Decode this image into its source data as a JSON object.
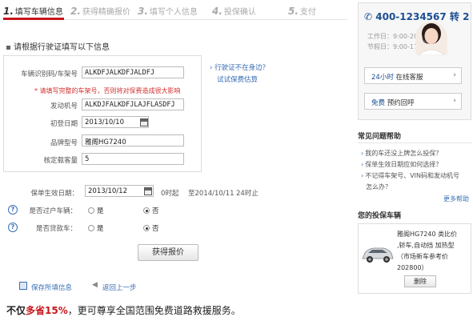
{
  "steps": [
    {
      "num": "1.",
      "label": "填写车辆信息"
    },
    {
      "num": "2.",
      "label": "获得精确报价"
    },
    {
      "num": "3.",
      "label": "填写个人信息"
    },
    {
      "num": "4.",
      "label": "投保确认"
    },
    {
      "num": "5.",
      "label": "支付"
    }
  ],
  "section_title": "请根据行驶证填写以下信息",
  "form": {
    "vin_label": "车辆识别码/车架号",
    "vin_value": "ALKDFJALKDFJALDFJ",
    "vin_warning": "* 请填写完整的车架号，否则将对保费造成很大影响",
    "engine_label": "发动机号",
    "engine_value": "ALKDJFALKDFJLAJFLASDFJ",
    "reg_date_label": "初登日期",
    "reg_date_value": "2013/10/10",
    "model_label": "品牌型号",
    "model_value": "雅阁HG7240",
    "seats_label": "核定载客量",
    "seats_value": "5"
  },
  "help": {
    "no_license": "行驶证不在身边？",
    "try_estimate": "试试保费估算"
  },
  "policy": {
    "start_label": "保单生效日期：",
    "start_date": "2013/10/12",
    "start_hour": "0时起",
    "end_text": "至2014/10/11",
    "end_hour": "24时止"
  },
  "transfer": {
    "label": "是否过户车辆：",
    "yes": "是",
    "no": "否",
    "selected": "no"
  },
  "loan": {
    "label": "是否贷款车：",
    "yes": "是",
    "no": "否",
    "selected": "no"
  },
  "quote_button": "获得报价",
  "save_link": "保存所填信息",
  "back_link": "返回上一步",
  "promo": {
    "prefix": "不仅",
    "highlight": "多省15%",
    "rest": "，更可尊享全国范围免费道路救援服务。"
  },
  "sidebar": {
    "phone": "400-1234567",
    "ext": "转 2",
    "workday": "工作日：9:00-20:00",
    "holiday": "节假日：9:00-17:00",
    "online_prefix": "24小时",
    "online_label": "在线客服",
    "callback_prefix": "免费",
    "callback_label": "预约回呼",
    "faq_title": "常见问题帮助",
    "faq": [
      "我的车还没上牌怎么投保？",
      "保单生效日期应如何选择？",
      "不记得车架号、VIN码和发动机号",
      "怎么办？"
    ],
    "more": "更多帮助",
    "car_title": "您的投保车辆",
    "car_desc": [
      "雅阁HG7240 类比价",
      ",轿车,自动挡 加热型",
      "（市场新车参考价",
      "202800）"
    ],
    "delete": "删除"
  }
}
